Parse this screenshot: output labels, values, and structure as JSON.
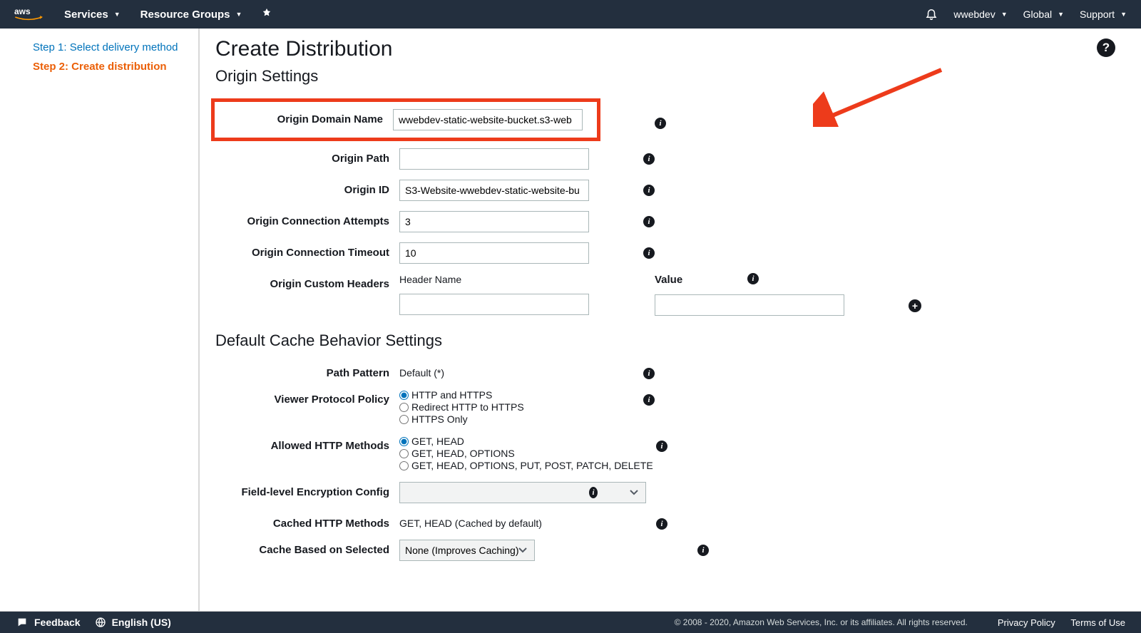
{
  "nav": {
    "services": "Services",
    "resource_groups": "Resource Groups",
    "user": "wwebdev",
    "region": "Global",
    "support": "Support"
  },
  "sidebar": {
    "step1": "Step 1: Select delivery method",
    "step2": "Step 2: Create distribution"
  },
  "page": {
    "title": "Create Distribution",
    "section_origin": "Origin Settings",
    "section_cache": "Default Cache Behavior Settings"
  },
  "origin": {
    "domain_label": "Origin Domain Name",
    "domain_value": "wwebdev-static-website-bucket.s3-web",
    "path_label": "Origin Path",
    "path_value": "",
    "id_label": "Origin ID",
    "id_value": "S3-Website-wwebdev-static-website-bu",
    "attempts_label": "Origin Connection Attempts",
    "attempts_value": "3",
    "timeout_label": "Origin Connection Timeout",
    "timeout_value": "10",
    "headers_label": "Origin Custom Headers",
    "headers_name": "Header Name",
    "headers_value": "Value"
  },
  "cache": {
    "path_label": "Path Pattern",
    "path_value": "Default (*)",
    "viewer_label": "Viewer Protocol Policy",
    "viewer_opts": [
      "HTTP and HTTPS",
      "Redirect HTTP to HTTPS",
      "HTTPS Only"
    ],
    "methods_label": "Allowed HTTP Methods",
    "methods_opts": [
      "GET, HEAD",
      "GET, HEAD, OPTIONS",
      "GET, HEAD, OPTIONS, PUT, POST, PATCH, DELETE"
    ],
    "fle_label": "Field-level Encryption Config",
    "cached_label": "Cached HTTP Methods",
    "cached_value": "GET, HEAD (Cached by default)",
    "cbs_label": "Cache Based on Selected",
    "cbs_value": "None (Improves Caching)"
  },
  "footer": {
    "feedback": "Feedback",
    "lang": "English (US)",
    "copyright": "© 2008 - 2020, Amazon Web Services, Inc. or its affiliates. All rights reserved.",
    "privacy": "Privacy Policy",
    "terms": "Terms of Use"
  }
}
